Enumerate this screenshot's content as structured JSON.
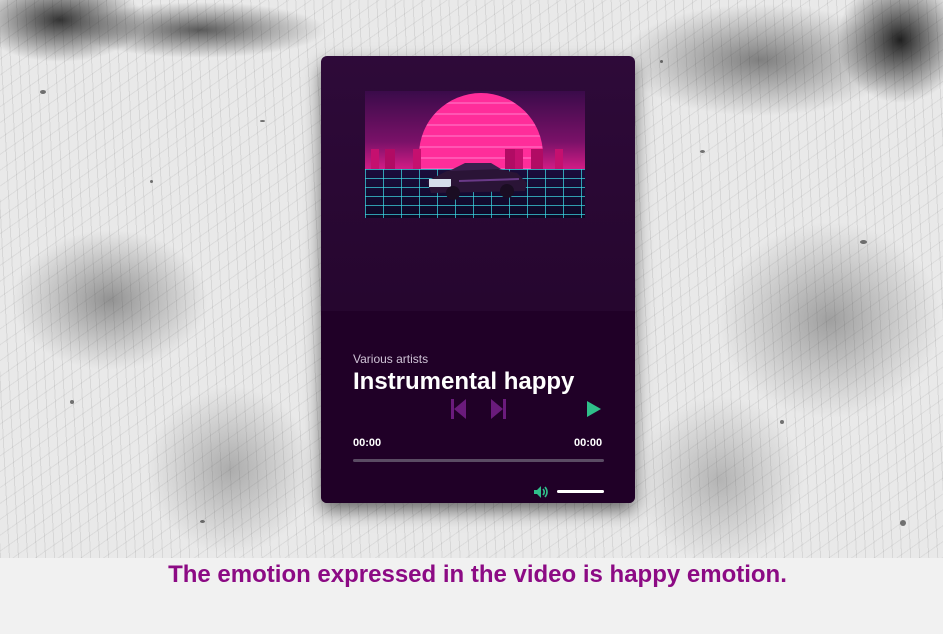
{
  "player": {
    "artist": "Various artists",
    "title": "Instrumental happy",
    "time_current": "00:00",
    "time_total": "00:00",
    "progress": 0,
    "volume": 1.0,
    "controls": {
      "prev_icon": "skip-back-icon",
      "next_icon": "skip-forward-icon",
      "play_icon": "play-icon",
      "volume_icon": "volume-icon"
    },
    "colors": {
      "card_bg": "#26062f",
      "control_purple": "#6a1b7c",
      "play_green": "#2fbf8a",
      "volume_green": "#2fbf8a"
    }
  },
  "caption": {
    "text": "The emotion expressed in the video is happy emotion.",
    "color": "#8c0a84"
  }
}
